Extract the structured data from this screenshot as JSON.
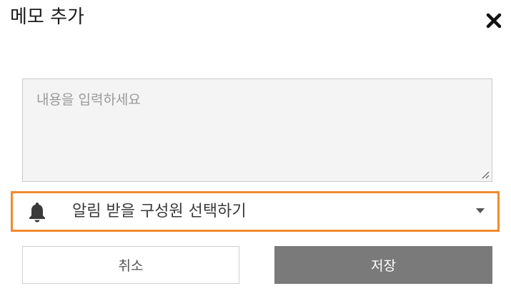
{
  "dialog": {
    "title": "메모 추가",
    "close_icon": "close-icon"
  },
  "memo": {
    "placeholder": "내용을 입력하세요",
    "value": ""
  },
  "member_select": {
    "icon": "bell-icon",
    "label": "알림 받을 구성원 선택하기",
    "chevron_icon": "chevron-down-icon",
    "highlight_color": "#f28a2e"
  },
  "actions": {
    "cancel_label": "취소",
    "save_label": "저장",
    "save_bg_color": "#7a7a7a"
  }
}
